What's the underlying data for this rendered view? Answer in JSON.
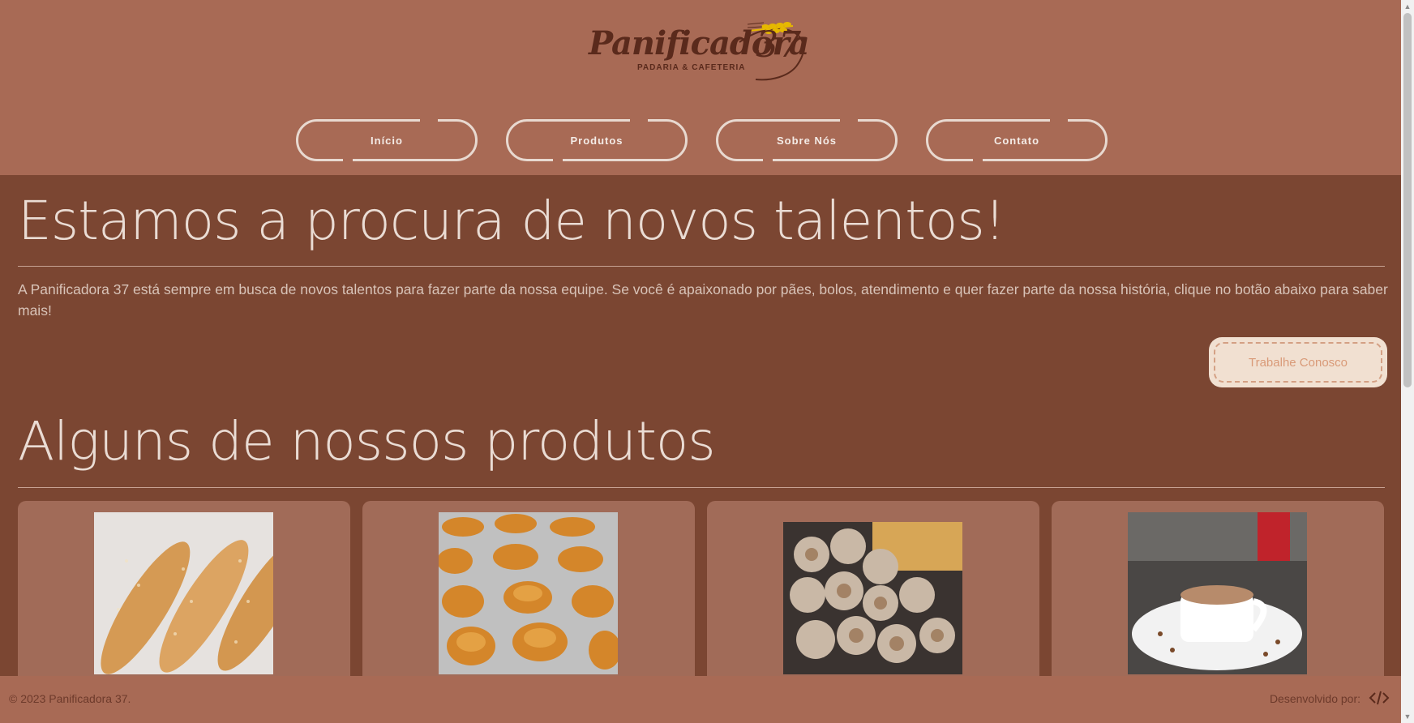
{
  "header": {
    "logo": {
      "name": "Panificadora",
      "number": "37",
      "tagline": "PADARIA & CAFETERIA"
    },
    "nav": [
      {
        "label": "Início"
      },
      {
        "label": "Produtos"
      },
      {
        "label": "Sobre Nós"
      },
      {
        "label": "Contato"
      }
    ]
  },
  "jobs": {
    "title": "Estamos a procura de novos talentos!",
    "text": "A Panificadora 37 está sempre em busca de novos talentos para fazer parte da nossa equipe. Se você é apaixonado por pães, bolos, atendimento e quer fazer parte da nossa história, clique no botão abaixo para saber mais!",
    "button": "Trabalhe Conosco"
  },
  "products": {
    "title": "Alguns de nossos produtos",
    "items": [
      {
        "image": "bread-image"
      },
      {
        "image": "cake-image"
      },
      {
        "image": "pastry-image"
      },
      {
        "image": "coffee-image"
      }
    ]
  },
  "footer": {
    "copyright": "© 2023 Panificadora 37.",
    "developed_by": "Desenvolvido por:",
    "dev_icon": "code-icon"
  },
  "colors": {
    "header_bg": "#a86a55",
    "main_bg": "#7b4632",
    "card_bg": "#a16b58",
    "button_bg": "#f1e0d1"
  }
}
